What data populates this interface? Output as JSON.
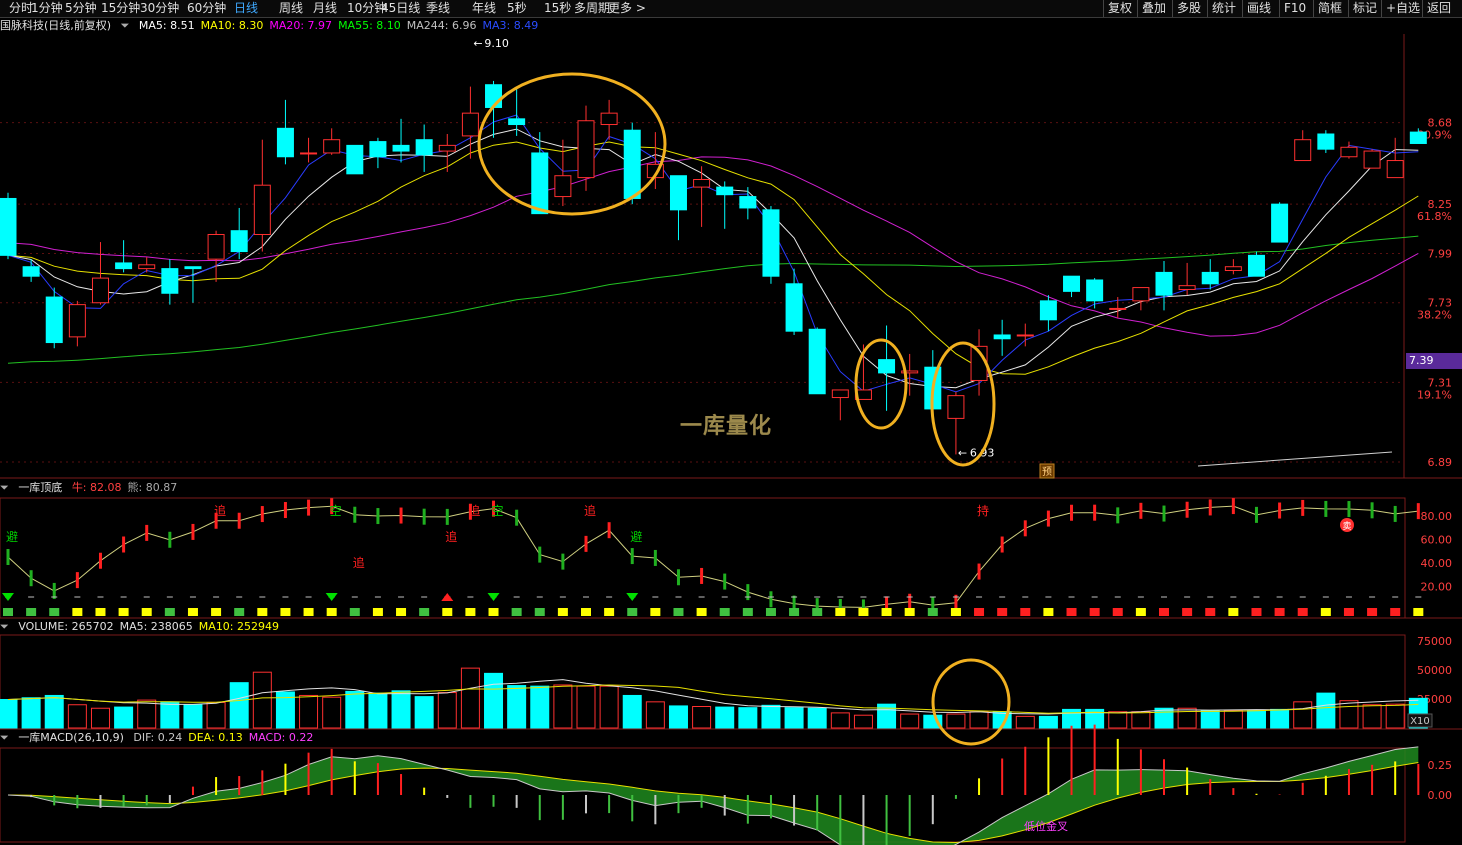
{
  "toolbar": {
    "tabs": [
      "分时",
      "1分钟",
      "5分钟",
      "15分钟",
      "30分钟",
      "60分钟",
      "日线",
      "周线",
      "月线",
      "10分钟",
      "45日线",
      "季线",
      "年线",
      "5秒",
      "15秒",
      "多周期",
      "更多 >"
    ],
    "active_tab": "日线",
    "right_buttons": [
      "复权",
      "叠加",
      "多股",
      "统计",
      "画线",
      "F10",
      "简框",
      "标记",
      "+自选",
      "返回"
    ]
  },
  "main_panel": {
    "title": "国脉科技(日线,前复权)",
    "ma_labels": [
      {
        "text": "MA5: 8.51",
        "color": "#ffffff"
      },
      {
        "text": "MA10: 8.30",
        "color": "#ffff00"
      },
      {
        "text": "MA20: 7.97",
        "color": "#ff00ff"
      },
      {
        "text": "MA55: 8.10",
        "color": "#00ff00"
      },
      {
        "text": "MA244: 6.96",
        "color": "#c0c0c0"
      },
      {
        "text": "MA3: 8.49",
        "color": "#2a4cff"
      }
    ],
    "high_marker": "9.10",
    "low_marker": "6.93",
    "yu_badge": "预",
    "watermark": "一库量化",
    "current_price_tag": "7.39",
    "y_axis": [
      {
        "price": "8.68",
        "pct": "80.9%",
        "v": 8.68
      },
      {
        "price": "8.25",
        "pct": "61.8%",
        "v": 8.25
      },
      {
        "price": "7.99",
        "pct": "",
        "v": 7.99
      },
      {
        "price": "7.73",
        "pct": "38.2%",
        "v": 7.73
      },
      {
        "price": "7.31",
        "pct": "19.1%",
        "v": 7.31
      },
      {
        "price": "6.89",
        "pct": "",
        "v": 6.89
      }
    ]
  },
  "dingdi_panel": {
    "title": "一库顶底",
    "values": [
      {
        "text": "牛: 82.08",
        "color": "#ff4040"
      },
      {
        "text": "熊: 80.87",
        "color": "#aaaaaa"
      }
    ],
    "y_axis": [
      "80.00",
      "60.00",
      "40.00",
      "20.00"
    ],
    "signals": [
      {
        "i": 0,
        "text": "避",
        "color": "#00d000",
        "pos": "mid"
      },
      {
        "i": 9,
        "text": "追",
        "color": "#ff2020",
        "pos": "top"
      },
      {
        "i": 14,
        "text": "空",
        "color": "#00d000",
        "pos": "top"
      },
      {
        "i": 15,
        "text": "追",
        "color": "#ff2020",
        "pos": "bot"
      },
      {
        "i": 19,
        "text": "追",
        "color": "#ff2020",
        "pos": "mid"
      },
      {
        "i": 20,
        "text": "追",
        "color": "#ff2020",
        "pos": "top"
      },
      {
        "i": 21,
        "text": "空",
        "color": "#00d000",
        "pos": "top"
      },
      {
        "i": 25,
        "text": "追",
        "color": "#ff2020",
        "pos": "top"
      },
      {
        "i": 27,
        "text": "避",
        "color": "#00d000",
        "pos": "mid"
      },
      {
        "i": 42,
        "text": "持",
        "color": "#ff2020",
        "pos": "top"
      }
    ],
    "sell_badge": "卖"
  },
  "volume_panel": {
    "labels": [
      {
        "text": "VOLUME: 265702",
        "color": "#e0e0e0"
      },
      {
        "text": "MA5: 238065",
        "color": "#e0e0e0"
      },
      {
        "text": "MA10: 252949",
        "color": "#ffff00"
      }
    ],
    "y_axis": [
      "75000",
      "50000",
      "25000"
    ],
    "unit": "X10"
  },
  "macd_panel": {
    "title": "一库MACD(26,10,9)",
    "labels": [
      {
        "text": "DIF: 0.24",
        "color": "#c8c8c8"
      },
      {
        "text": "DEA: 0.13",
        "color": "#ffff00"
      },
      {
        "text": "MACD: 0.22",
        "color": "#ff40ff"
      }
    ],
    "y_axis": [
      "0.25",
      "0.00"
    ],
    "annotation": "低位金叉"
  },
  "chart_data": {
    "type": "candlestick",
    "ylim": [
      6.89,
      9.1
    ],
    "candles": [
      [
        8.28,
        7.98,
        8.31,
        7.96
      ],
      [
        7.92,
        7.87,
        7.96,
        7.84
      ],
      [
        7.76,
        7.52,
        7.81,
        7.49
      ],
      [
        7.55,
        7.72,
        7.74,
        7.5
      ],
      [
        7.73,
        7.86,
        8.05,
        7.72
      ],
      [
        7.94,
        7.91,
        8.06,
        7.89
      ],
      [
        7.91,
        7.93,
        7.97,
        7.89
      ],
      [
        7.91,
        7.78,
        7.96,
        7.72
      ],
      [
        7.92,
        7.91,
        7.92,
        7.73
      ],
      [
        7.96,
        8.09,
        8.11,
        7.84
      ],
      [
        8.11,
        8.0,
        8.23,
        7.96
      ],
      [
        8.09,
        8.35,
        8.59,
        8.0
      ],
      [
        8.65,
        8.5,
        8.8,
        8.46
      ],
      [
        8.52,
        8.52,
        8.6,
        8.47
      ],
      [
        8.52,
        8.59,
        8.65,
        8.51
      ],
      [
        8.56,
        8.41,
        8.55,
        8.42
      ],
      [
        8.58,
        8.5,
        8.6,
        8.44
      ],
      [
        8.56,
        8.53,
        8.7,
        8.47
      ],
      [
        8.59,
        8.51,
        8.67,
        8.42
      ],
      [
        8.53,
        8.56,
        8.62,
        8.42
      ],
      [
        8.61,
        8.73,
        8.87,
        8.49
      ],
      [
        8.88,
        8.76,
        8.9,
        8.6
      ],
      [
        8.7,
        8.67,
        8.87,
        8.61
      ],
      [
        8.52,
        8.2,
        8.63,
        8.2
      ],
      [
        8.29,
        8.4,
        8.59,
        8.24
      ],
      [
        8.39,
        8.69,
        8.77,
        8.32
      ],
      [
        8.67,
        8.73,
        8.8,
        8.59
      ],
      [
        8.64,
        8.28,
        8.68,
        8.25
      ],
      [
        8.39,
        8.46,
        8.63,
        8.33
      ],
      [
        8.4,
        8.22,
        8.34,
        8.06
      ],
      [
        8.34,
        8.38,
        8.45,
        8.13
      ],
      [
        8.34,
        8.3,
        8.37,
        8.12
      ],
      [
        8.29,
        8.23,
        8.34,
        8.17
      ],
      [
        8.22,
        7.87,
        8.24,
        7.83
      ],
      [
        7.83,
        7.58,
        7.91,
        7.56
      ],
      [
        7.59,
        7.25,
        7.6,
        7.26
      ],
      [
        7.23,
        7.27,
        7.27,
        7.11
      ],
      [
        7.22,
        7.27,
        7.51,
        7.24
      ],
      [
        7.43,
        7.36,
        7.61,
        7.16
      ],
      [
        7.36,
        7.37,
        7.46,
        7.24
      ],
      [
        7.39,
        7.17,
        7.48,
        7.2
      ],
      [
        7.12,
        7.24,
        7.26,
        6.93
      ],
      [
        7.32,
        7.5,
        7.59,
        7.24
      ],
      [
        7.56,
        7.54,
        7.64,
        7.45
      ],
      [
        7.56,
        7.56,
        7.62,
        7.5
      ],
      [
        7.74,
        7.64,
        7.77,
        7.58
      ],
      [
        7.87,
        7.79,
        7.87,
        7.76
      ],
      [
        7.85,
        7.74,
        7.86,
        7.7
      ],
      [
        7.7,
        7.7,
        7.76,
        7.65
      ],
      [
        7.74,
        7.81,
        7.81,
        7.69
      ],
      [
        7.89,
        7.77,
        7.95,
        7.69
      ],
      [
        7.8,
        7.82,
        7.94,
        7.77
      ],
      [
        7.89,
        7.83,
        7.96,
        7.8
      ],
      [
        7.9,
        7.92,
        7.96,
        7.88
      ],
      [
        7.98,
        7.87,
        8.0,
        7.88
      ],
      [
        8.25,
        8.05,
        8.26,
        8.05
      ],
      [
        8.48,
        8.59,
        8.64,
        8.49
      ],
      [
        8.62,
        8.54,
        8.64,
        8.52
      ],
      [
        8.5,
        8.55,
        8.58,
        8.49
      ],
      [
        8.44,
        8.53,
        8.54,
        8.44
      ],
      [
        8.39,
        8.48,
        8.6,
        8.39
      ],
      [
        8.63,
        8.57,
        8.65,
        8.59
      ]
    ]
  }
}
